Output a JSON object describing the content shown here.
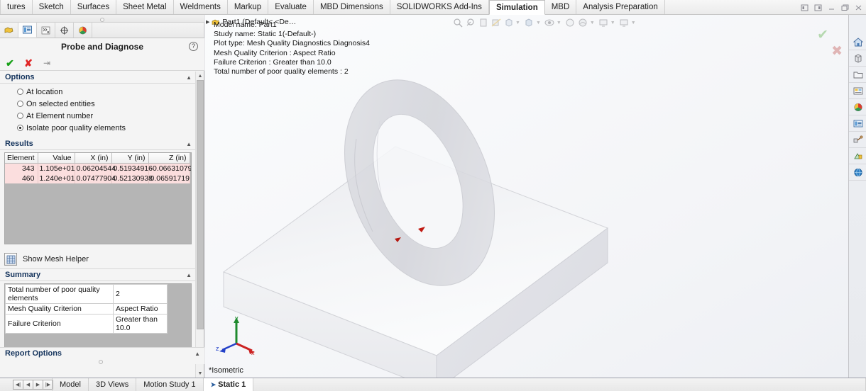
{
  "ribbon": {
    "tabs": [
      {
        "label": "tures",
        "active": false
      },
      {
        "label": "Sketch",
        "active": false
      },
      {
        "label": "Surfaces",
        "active": false
      },
      {
        "label": "Sheet Metal",
        "active": false
      },
      {
        "label": "Weldments",
        "active": false
      },
      {
        "label": "Markup",
        "active": false
      },
      {
        "label": "Evaluate",
        "active": false
      },
      {
        "label": "MBD Dimensions",
        "active": false
      },
      {
        "label": "SOLIDWORKS Add-Ins",
        "active": false
      },
      {
        "label": "Simulation",
        "active": true
      },
      {
        "label": "MBD",
        "active": false
      },
      {
        "label": "Analysis Preparation",
        "active": false
      }
    ]
  },
  "window_controls": [
    {
      "name": "restore-left-icon"
    },
    {
      "name": "restore-right-icon"
    },
    {
      "name": "minimize-icon"
    },
    {
      "name": "maximize-icon"
    },
    {
      "name": "close-icon"
    }
  ],
  "panel": {
    "tabs": [
      {
        "name": "feature-manager-tree-tab",
        "selected": false
      },
      {
        "name": "property-manager-tab",
        "selected": true
      },
      {
        "name": "configuration-manager-tab",
        "selected": false
      },
      {
        "name": "dimxpert-manager-tab",
        "selected": false
      },
      {
        "name": "display-manager-tab",
        "selected": false
      }
    ],
    "title": "Probe and Diagnose",
    "help_label": "?",
    "actions": [
      {
        "name": "accept-button",
        "glyph": "✔"
      },
      {
        "name": "cancel-button",
        "glyph": "✘"
      },
      {
        "name": "pin-button",
        "glyph": "⇥"
      }
    ],
    "options": {
      "header": "Options",
      "items": [
        {
          "label": "At location",
          "selected": false
        },
        {
          "label": "On selected entities",
          "selected": false
        },
        {
          "label": "At Element number",
          "selected": false
        },
        {
          "label": "Isolate poor quality elements",
          "selected": true
        }
      ]
    },
    "results": {
      "header": "Results",
      "columns": [
        "Element",
        "Value",
        "X (in)",
        "Y (in)",
        "Z (in)"
      ],
      "rows": [
        [
          "343",
          "1.105e+01",
          "0.06204544",
          "0.51934916",
          "-0.06631079"
        ],
        [
          "460",
          "1.240e+01",
          "0.07477904",
          "0.52130938",
          "0.06591719"
        ]
      ]
    },
    "mesh_helper_label": "Show Mesh Helper",
    "summary": {
      "header": "Summary",
      "rows": [
        {
          "key": "Total number of poor quality elements",
          "value": "2"
        },
        {
          "key": "Mesh Quality Criterion",
          "value": "Aspect Ratio"
        },
        {
          "key": "Failure Criterion",
          "value": "Greater than 10.0"
        }
      ]
    },
    "report_options_header": "Report Options"
  },
  "viewport": {
    "tree_stub": "Part1  (Default< <De…",
    "annotation": [
      "Model name: Part1",
      "Study name: Static 1(-Default-)",
      "Plot type: Mesh Quality Diagnostics Diagnosis4",
      "Mesh Quality Criterion : Aspect Ratio",
      "Failure Criterion : Greater than 10.0",
      "Total number of poor quality elements : 2"
    ],
    "view_label": "*Isometric",
    "triad": {
      "x": "x",
      "y": "y",
      "z": "z"
    },
    "hud_icons": [
      "zoom-to-fit-icon",
      "zoom-to-area-icon",
      "previous-view-icon",
      "section-view-icon",
      "view-orientation-icon",
      "display-style-icon",
      "hide-show-items-icon",
      "edit-appearance-icon",
      "apply-scene-icon",
      "view-settings-icon",
      "display-state-icon"
    ],
    "confirm_ok": "✔",
    "confirm_cancel": "✖"
  },
  "task_pane": [
    {
      "name": "sw-resources-icon"
    },
    {
      "name": "design-library-icon"
    },
    {
      "name": "file-explorer-icon"
    },
    {
      "name": "view-palette-icon"
    },
    {
      "name": "appearances-scenes-icon"
    },
    {
      "name": "custom-properties-icon"
    },
    {
      "name": "solidworks-forum-icon"
    },
    {
      "name": "simulation-icon"
    },
    {
      "name": "3dexperience-icon"
    }
  ],
  "bottom": {
    "nav_buttons": [
      "first-icon",
      "previous-icon",
      "next-icon",
      "last-icon"
    ],
    "tabs": [
      {
        "label": "Model",
        "active": false,
        "pinned": false
      },
      {
        "label": "3D Views",
        "active": false,
        "pinned": false
      },
      {
        "label": "Motion Study 1",
        "active": false,
        "pinned": false
      },
      {
        "label": "Static 1",
        "active": true,
        "pinned": true
      }
    ]
  },
  "colors": {
    "accent": "#14335c",
    "error_row": "#fbdede",
    "accept": "#17a017",
    "cancel": "#e02626",
    "poor_element": "#c01a12"
  }
}
